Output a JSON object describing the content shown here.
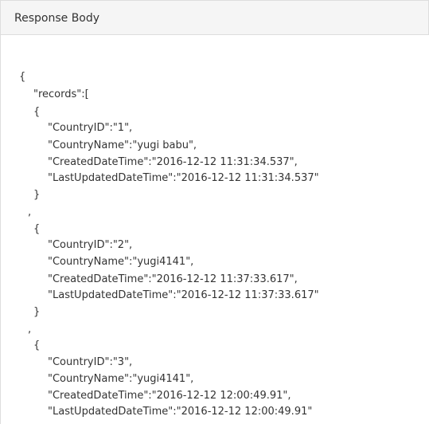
{
  "panel": {
    "title": "Response Body"
  },
  "json_lines": [
    "{",
    "\"records\":[",
    "{",
    "\"CountryID\":\"1\",",
    "\"CountryName\":\"yugi babu\",",
    "\"CreatedDateTime\":\"2016-12-12 11:31:34.537\",",
    "\"LastUpdatedDateTime\":\"2016-12-12 11:31:34.537\"",
    "}",
    ",",
    "{",
    "\"CountryID\":\"2\",",
    "\"CountryName\":\"yugi4141\",",
    "\"CreatedDateTime\":\"2016-12-12 11:37:33.617\",",
    "\"LastUpdatedDateTime\":\"2016-12-12 11:37:33.617\"",
    "}",
    ",",
    "{",
    "\"CountryID\":\"3\",",
    "\"CountryName\":\"yugi4141\",",
    "\"CreatedDateTime\":\"2016-12-12 12:00:49.91\",",
    "\"LastUpdatedDateTime\":\"2016-12-12 12:00:49.91\""
  ]
}
